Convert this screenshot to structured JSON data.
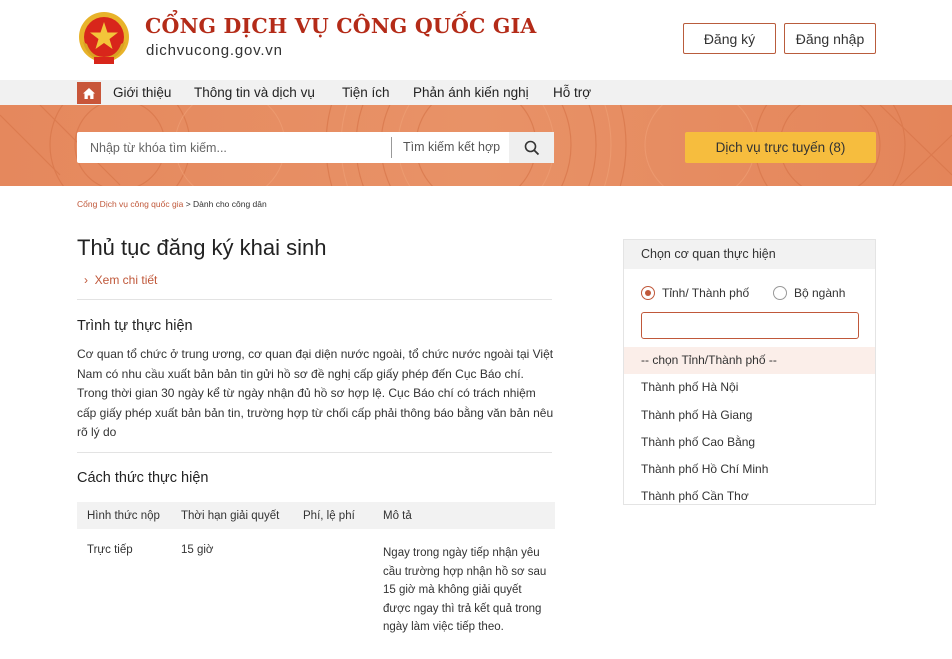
{
  "header": {
    "site_title": "CỔNG DỊCH VỤ CÔNG QUỐC GIA",
    "site_domain": "dichvucong.gov.vn",
    "register_label": "Đăng ký",
    "login_label": "Đăng nhập"
  },
  "nav": {
    "items": [
      "Giới thiệu",
      "Thông tin và dịch vụ",
      "Tiện ích",
      "Phản ánh kiến nghị",
      "Hỗ trợ"
    ]
  },
  "search": {
    "placeholder": "Nhập từ khóa tìm kiếm...",
    "advanced_label": "Tìm kiếm kết hợp",
    "online_services_label": "Dịch vụ trực tuyến (8)"
  },
  "breadcrumb": {
    "home": "Cổng Dịch vụ công quốc gia",
    "separator": " > ",
    "current": "Dành cho công dân"
  },
  "main": {
    "title": "Thủ tục đăng ký khai sinh",
    "detail_link": "Xem chi tiết",
    "sequence_title": "Trình tự thực hiện",
    "sequence_text": "Cơ quan tổ chức ở trung ương, cơ quan đại diện nước ngoài, tổ chức nước ngoài tại Việt Nam có nhu cầu xuất bản bản tin gửi hồ sơ đề nghị cấp giấy phép đến Cục Báo chí. Trong thời gian 30 ngày kể từ ngày nhận đủ hồ sơ hợp lệ. Cục Báo chí có trách nhiệm cấp giấy phép xuất bản bản tin, trường hợp từ chối cấp phải thông báo bằng văn bản nêu rõ lý do",
    "method_title": "Cách thức thực hiện",
    "table": {
      "headers": [
        "Hình thức nộp",
        "Thời hạn giải quyết",
        "Phí, lệ phí",
        "Mô tả"
      ],
      "rows": [
        [
          "Trực tiếp",
          "15 giờ",
          "",
          "Ngay trong ngày tiếp nhận yêu cầu trường hợp nhận hồ sơ sau 15 giờ mà không giải quyết được ngay thì trả kết quả trong ngày làm việc tiếp theo."
        ]
      ]
    }
  },
  "sidebar": {
    "title": "Chọn cơ quan thực hiện",
    "radio_province": "Tỉnh/ Thành phố",
    "radio_ministry": "Bộ ngành",
    "selected_radio": "province",
    "input_value": "",
    "options": [
      "-- chọn Tỉnh/Thành phố --",
      "Thành phố Hà Nội",
      "Thành phố Hà Giang",
      "Thành phố Cao Bằng",
      "Thành phố Hồ Chí Minh",
      "Thành phố Cần Thơ"
    ]
  },
  "colors": {
    "brand_red": "#b42b18",
    "accent_orange": "#c0583a",
    "banner": "#e68b5f",
    "online_button": "#f6bd3e"
  }
}
